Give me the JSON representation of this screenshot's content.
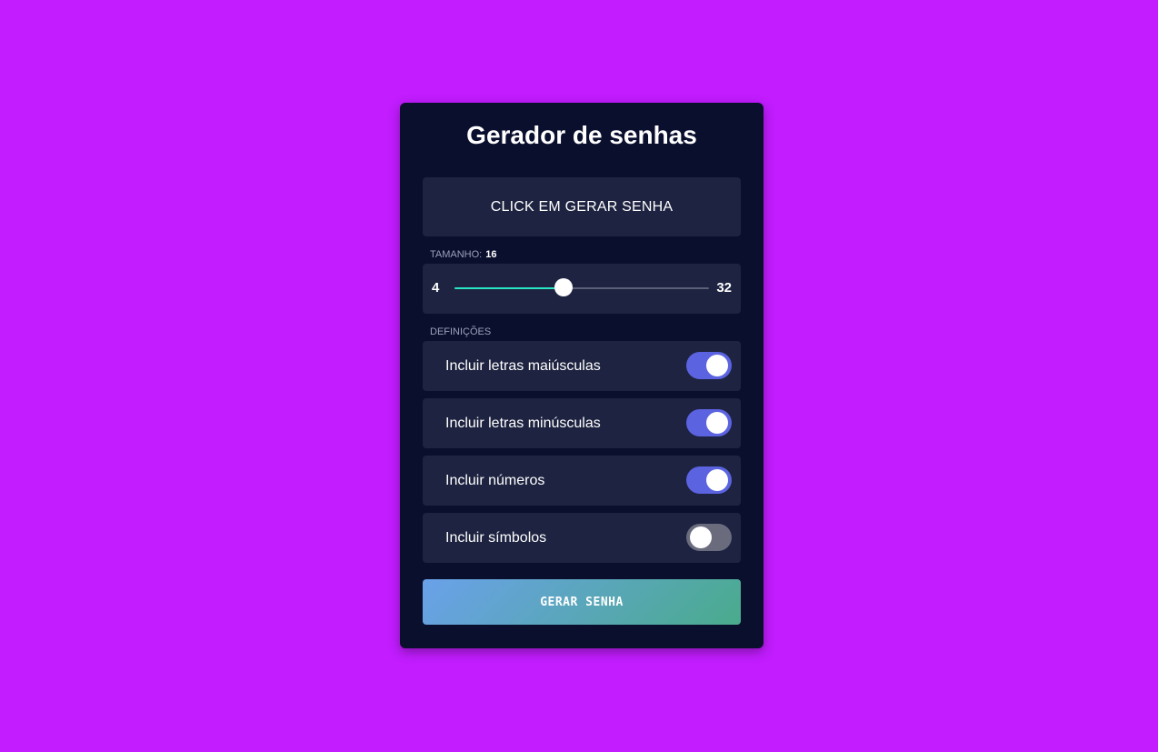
{
  "app": {
    "title": "Gerador de senhas"
  },
  "result": {
    "text": "CLICK EM GERAR SENHA"
  },
  "length": {
    "label": "TAMANHO:",
    "value": 16,
    "min": 4,
    "max": 32
  },
  "settings": {
    "label": "DEFINIÇÕES",
    "items": [
      {
        "label": "Incluir letras maiúsculas",
        "enabled": true
      },
      {
        "label": "Incluir letras minúsculas",
        "enabled": true
      },
      {
        "label": "Incluir números",
        "enabled": true
      },
      {
        "label": "Incluir símbolos",
        "enabled": false
      }
    ]
  },
  "button": {
    "label": "GERAR SENHA"
  },
  "colors": {
    "background": "#c21cff",
    "card": "#0b0f2e",
    "panel": "#1d2340",
    "toggle_on": "#5b63e0",
    "toggle_off": "#6a6c7e",
    "slider_fill": "#29e5c4"
  }
}
